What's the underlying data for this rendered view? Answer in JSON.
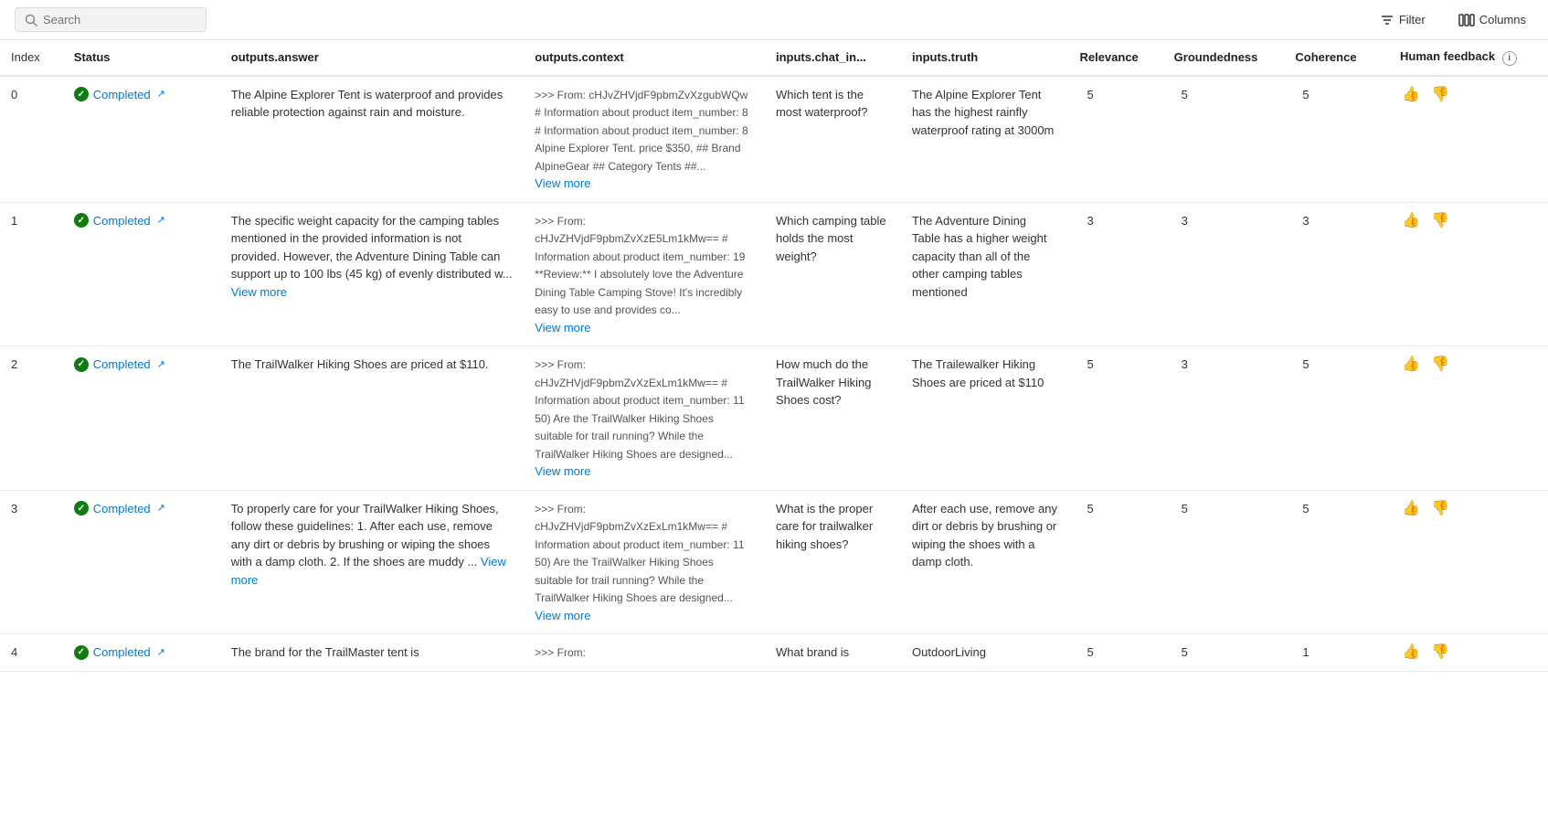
{
  "toolbar": {
    "search_placeholder": "Search",
    "filter_label": "Filter",
    "columns_label": "Columns"
  },
  "table": {
    "columns": [
      {
        "id": "index",
        "label": "Index"
      },
      {
        "id": "status",
        "label": "Status"
      },
      {
        "id": "outputs_answer",
        "label": "outputs.answer"
      },
      {
        "id": "outputs_context",
        "label": "outputs.context"
      },
      {
        "id": "inputs_chat_in",
        "label": "inputs.chat_in..."
      },
      {
        "id": "inputs_truth",
        "label": "inputs.truth"
      },
      {
        "id": "relevance",
        "label": "Relevance"
      },
      {
        "id": "groundedness",
        "label": "Groundedness"
      },
      {
        "id": "coherence",
        "label": "Coherence"
      },
      {
        "id": "human_feedback",
        "label": "Human feedback"
      }
    ],
    "rows": [
      {
        "index": "0",
        "status": "Completed",
        "answer": "The Alpine Explorer Tent is waterproof and provides reliable protection against rain and moisture.",
        "context": ">>> From: cHJvZHVjdF9pbmZvXzgubWQw # Information about product item_number: 8 # Information about product item_number: 8 Alpine Explorer Tent. price $350, ## Brand AlpineGear ## Category Tents ##...",
        "context_has_more": true,
        "chat_in": "Which tent is the most waterproof?",
        "truth": "The Alpine Explorer Tent has the highest rainfly waterproof rating at 3000m",
        "relevance": "5",
        "groundedness": "5",
        "coherence": "5"
      },
      {
        "index": "1",
        "status": "Completed",
        "answer": "The specific weight capacity for the camping tables mentioned in the provided information is not provided. However, the Adventure Dining Table can support up to 100 lbs (45 kg) of evenly distributed w...",
        "answer_has_more": true,
        "answer_more_text": "View more",
        "context": ">>> From: cHJvZHVjdF9pbmZvXzE5Lm1kMw== # Information about product item_number: 19 **Review:** I absolutely love the Adventure Dining Table Camping Stove! It's incredibly easy to use and provides co...",
        "context_has_more": true,
        "chat_in": "Which camping table holds the most weight?",
        "truth": "The Adventure Dining Table has a higher weight capacity than all of the other camping tables mentioned",
        "relevance": "3",
        "groundedness": "3",
        "coherence": "3"
      },
      {
        "index": "2",
        "status": "Completed",
        "answer": "The TrailWalker Hiking Shoes are priced at $110.",
        "context": ">>> From: cHJvZHVjdF9pbmZvXzExLm1kMw== # Information about product item_number: 11 50) Are the TrailWalker Hiking Shoes suitable for trail running? While the TrailWalker Hiking Shoes are designed...",
        "context_has_more": true,
        "chat_in": "How much do the TrailWalker Hiking Shoes cost?",
        "truth": "The Trailewalker Hiking Shoes are priced at $110",
        "relevance": "5",
        "groundedness": "3",
        "coherence": "5"
      },
      {
        "index": "3",
        "status": "Completed",
        "answer": "To properly care for your TrailWalker Hiking Shoes, follow these guidelines: 1. After each use, remove any dirt or debris by brushing or wiping the shoes with a damp cloth. 2. If the shoes are muddy ...",
        "answer_has_more": true,
        "answer_more_text": "View more",
        "context": ">>> From: cHJvZHVjdF9pbmZvXzExLm1kMw== # Information about product item_number: 11 50) Are the TrailWalker Hiking Shoes suitable for trail running? While the TrailWalker Hiking Shoes are designed...",
        "context_has_more": true,
        "chat_in": "What is the proper care for trailwalker hiking shoes?",
        "truth": "After each use, remove any dirt or debris by brushing or wiping the shoes with a damp cloth.",
        "relevance": "5",
        "groundedness": "5",
        "coherence": "5"
      },
      {
        "index": "4",
        "status": "Completed",
        "answer": "The brand for the TrailMaster tent is",
        "context": ">>> From:",
        "chat_in": "What brand is",
        "truth": "OutdoorLiving",
        "relevance": "5",
        "groundedness": "5",
        "coherence": "1"
      }
    ]
  }
}
